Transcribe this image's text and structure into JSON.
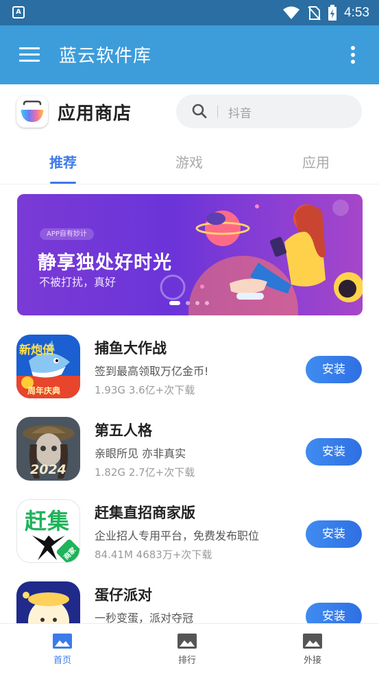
{
  "status_bar": {
    "notification_icon": "A",
    "time": "4:53",
    "icons": [
      "wifi-icon",
      "no-sim-icon",
      "battery-charging-icon"
    ]
  },
  "app_bar": {
    "title": "蓝云软件库",
    "menu_icon": "hamburger-menu-icon",
    "more_icon": "more-vertical-icon"
  },
  "store": {
    "name": "应用商店",
    "search": {
      "placeholder": "抖音",
      "icon": "search-icon"
    }
  },
  "tabs": [
    {
      "label": "推荐",
      "active": true
    },
    {
      "label": "游戏",
      "active": false
    },
    {
      "label": "应用",
      "active": false
    }
  ],
  "banner": {
    "tag": "APP自有妙计",
    "headline": "静享独处好时光",
    "subtitle": "不被打扰，真好",
    "slide_count": 4,
    "active_slide": 1
  },
  "apps": [
    {
      "name": "捕鱼大作战",
      "desc": "签到最高领取万亿金币!",
      "size": "1.93G",
      "downloads": "3.6亿+次下载",
      "button": "安装",
      "icon": "fishing-game-icon"
    },
    {
      "name": "第五人格",
      "desc": "亲眼所见 亦非真实",
      "size": "1.82G",
      "downloads": "2.7亿+次下载",
      "button": "安装",
      "icon": "identity-v-icon"
    },
    {
      "name": "赶集直招商家版",
      "desc": "企业招人专用平台，免费发布职位",
      "size": "84.41M",
      "downloads": "4683万+次下载",
      "button": "安装",
      "icon": "ganji-icon"
    },
    {
      "name": "蛋仔派对",
      "desc": "一秒变蛋，派对夺冠",
      "size": "",
      "downloads": "",
      "button": "安装",
      "icon": "eggy-party-icon"
    }
  ],
  "app_icon_text": {
    "fishing": [
      "新炮倍",
      "周年庆典"
    ],
    "identity_v": "2024",
    "ganji": [
      "赶集",
      "商家"
    ]
  },
  "bottom_nav": [
    {
      "label": "首页",
      "icon": "image-icon",
      "active": true
    },
    {
      "label": "排行",
      "icon": "image-icon",
      "active": false
    },
    {
      "label": "外接",
      "icon": "image-icon",
      "active": false
    }
  ],
  "colors": {
    "status_bar": "#2a6ea3",
    "app_bar": "#3d9ddb",
    "accent": "#3d7be8",
    "install_button": "#3f8cf0"
  }
}
